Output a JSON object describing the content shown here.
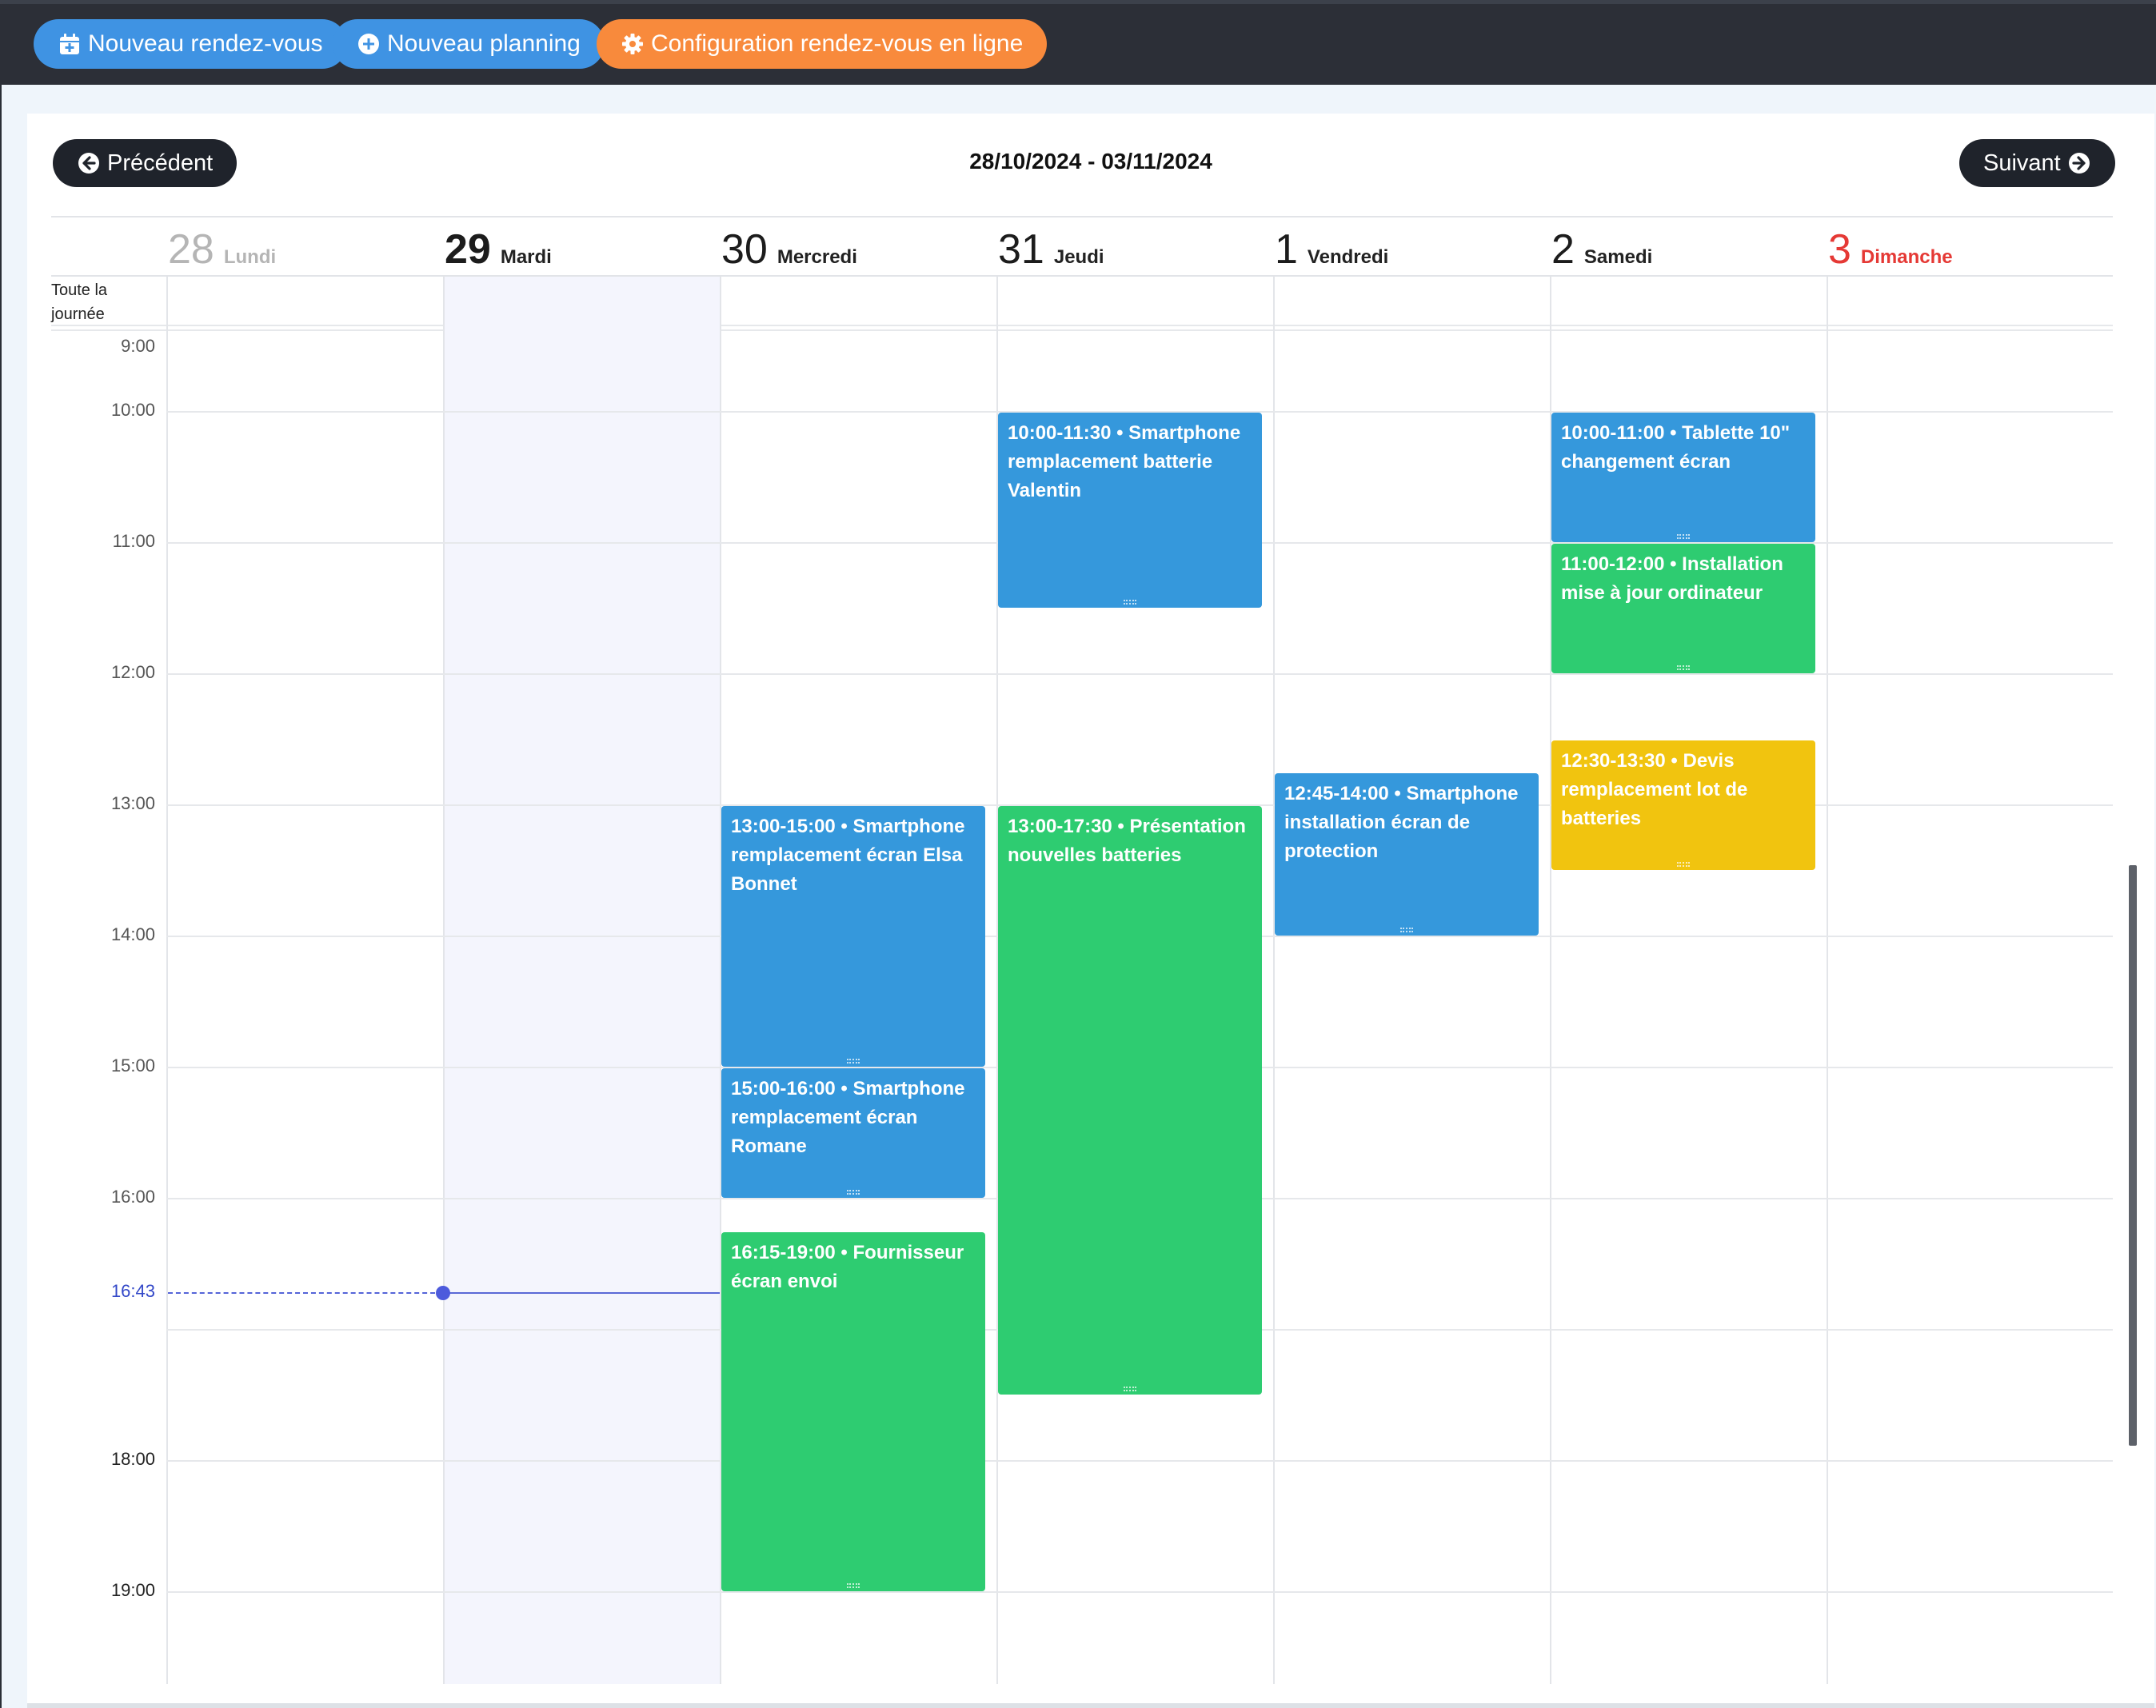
{
  "toolbar": {
    "new_appointment": "Nouveau rendez-vous",
    "new_schedule": "Nouveau planning",
    "online_config": "Configuration rendez-vous en ligne"
  },
  "calendar": {
    "prev_label": "Précédent",
    "next_label": "Suivant",
    "range": "28/10/2024 - 03/11/2024",
    "all_day_label": "Toute la journée",
    "days": [
      {
        "num": "28",
        "name": "Lundi",
        "state": "past"
      },
      {
        "num": "29",
        "name": "Mardi",
        "state": "today"
      },
      {
        "num": "30",
        "name": "Mercredi",
        "state": "normal"
      },
      {
        "num": "31",
        "name": "Jeudi",
        "state": "normal"
      },
      {
        "num": "1",
        "name": "Vendredi",
        "state": "normal"
      },
      {
        "num": "2",
        "name": "Samedi",
        "state": "normal"
      },
      {
        "num": "3",
        "name": "Dimanche",
        "state": "sunday"
      }
    ],
    "hours": [
      "9:00",
      "10:00",
      "11:00",
      "12:00",
      "13:00",
      "14:00",
      "15:00",
      "16:00",
      "",
      "18:00",
      "19:00"
    ],
    "now_label": "16:43",
    "events": [
      {
        "day": 3,
        "start": 10.0,
        "end": 11.5,
        "color": "#3598dc",
        "text": "10:00-11:30 • Smartphone remplacement batterie Valentin"
      },
      {
        "day": 5,
        "start": 10.0,
        "end": 11.0,
        "color": "#3598dc",
        "text": "10:00-11:00 • Tablette 10\" changement écran"
      },
      {
        "day": 5,
        "start": 11.0,
        "end": 12.0,
        "color": "#2ecc71",
        "text": "11:00-12:00 • Installation mise à jour ordinateur"
      },
      {
        "day": 5,
        "start": 12.5,
        "end": 13.5,
        "color": "#f1c40f",
        "text": "12:30-13:30 • Devis remplacement lot de batteries"
      },
      {
        "day": 4,
        "start": 12.75,
        "end": 14.0,
        "color": "#3598dc",
        "text": "12:45-14:00 • Smartphone installation écran de protection"
      },
      {
        "day": 2,
        "start": 13.0,
        "end": 15.0,
        "color": "#3598dc",
        "text": "13:00-15:00 • Smartphone remplacement écran Elsa Bonnet"
      },
      {
        "day": 3,
        "start": 13.0,
        "end": 17.5,
        "color": "#2ecc71",
        "text": "13:00-17:30 • Présentation nouvelles batteries"
      },
      {
        "day": 2,
        "start": 15.0,
        "end": 16.0,
        "color": "#3598dc",
        "text": "15:00-16:00 • Smartphone remplacement écran Romane"
      },
      {
        "day": 2,
        "start": 16.25,
        "end": 19.0,
        "color": "#2ecc71",
        "text": "16:15-19:00 • Fournisseur écran envoi"
      }
    ]
  },
  "icons": {
    "calendar_plus": "calendar-plus-icon",
    "plus_circle": "plus-circle-icon",
    "gear": "gear-icon",
    "arrow_left": "arrow-left-circle-icon",
    "arrow_right": "arrow-right-circle-icon"
  }
}
